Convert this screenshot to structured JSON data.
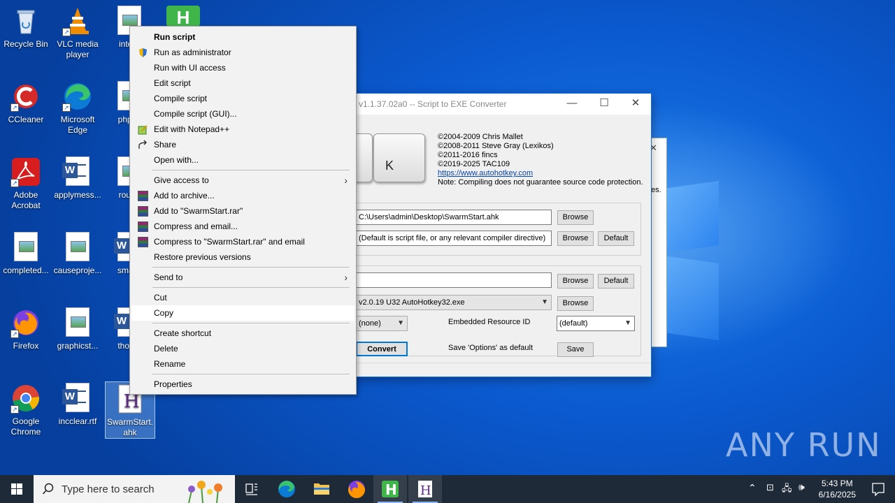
{
  "desktop": {
    "icons": [
      {
        "label": "Recycle Bin"
      },
      {
        "label": "VLC media player"
      },
      {
        "label": "intern"
      },
      {
        "label": "CCleaner"
      },
      {
        "label": "Microsoft Edge"
      },
      {
        "label": "phpca"
      },
      {
        "label": "Adobe Acrobat"
      },
      {
        "label": "applymess..."
      },
      {
        "label": "round"
      },
      {
        "label": "completed..."
      },
      {
        "label": "causeproje..."
      },
      {
        "label": "smallc"
      },
      {
        "label": "Firefox"
      },
      {
        "label": "graphicst..."
      },
      {
        "label": "thoma"
      },
      {
        "label": "Google Chrome"
      },
      {
        "label": "incclear.rtf"
      },
      {
        "label": "SwarmStart.ahk"
      }
    ]
  },
  "converter": {
    "title": "v1.1.37.02a0 -- Script to EXE Converter",
    "key_label": "K",
    "credits": [
      "©2004-2009 Chris Mallet",
      "©2008-2011 Steve Gray (Lexikos)",
      "©2011-2016 fincs",
      "©2019-2025 TAC109"
    ],
    "link": "https://www.autohotkey.com",
    "note": "Note: Compiling does not guarantee source code protection.",
    "source_value": "C:\\Users\\admin\\Desktop\\SwarmStart.ahk",
    "dest_value": "(Default is script file, or any relevant compiler directive)",
    "icon_value": "",
    "base_value": "v2.0.19 U32 AutoHotkey32.exe",
    "compression_value": "(none)",
    "resource_label": "Embedded Resource ID",
    "resource_value": "(default)",
    "save_options_label": "Save 'Options' as default",
    "buttons": {
      "browse": "Browse",
      "default": "Default",
      "convert": "Convert",
      "save": "Save"
    },
    "behind_text": "es."
  },
  "context_menu": {
    "items": [
      {
        "label": "Run script"
      },
      {
        "label": "Run as administrator"
      },
      {
        "label": "Run with UI access"
      },
      {
        "label": "Edit script"
      },
      {
        "label": "Compile script"
      },
      {
        "label": "Compile script (GUI)..."
      },
      {
        "label": "Edit with Notepad++"
      },
      {
        "label": "Share"
      },
      {
        "label": "Open with..."
      },
      {
        "label": "Give access to"
      },
      {
        "label": "Add to archive..."
      },
      {
        "label": "Add to \"SwarmStart.rar\""
      },
      {
        "label": "Compress and email..."
      },
      {
        "label": "Compress to \"SwarmStart.rar\" and email"
      },
      {
        "label": "Restore previous versions"
      },
      {
        "label": "Send to"
      },
      {
        "label": "Cut"
      },
      {
        "label": "Copy"
      },
      {
        "label": "Create shortcut"
      },
      {
        "label": "Delete"
      },
      {
        "label": "Rename"
      },
      {
        "label": "Properties"
      }
    ]
  },
  "taskbar": {
    "search_placeholder": "Type here to search",
    "time": "5:43 PM",
    "date": "6/16/2025"
  },
  "watermark": "ANY RUN",
  "colors": {
    "accent": "#0b5ad0",
    "taskbar": "#1f2a38"
  }
}
